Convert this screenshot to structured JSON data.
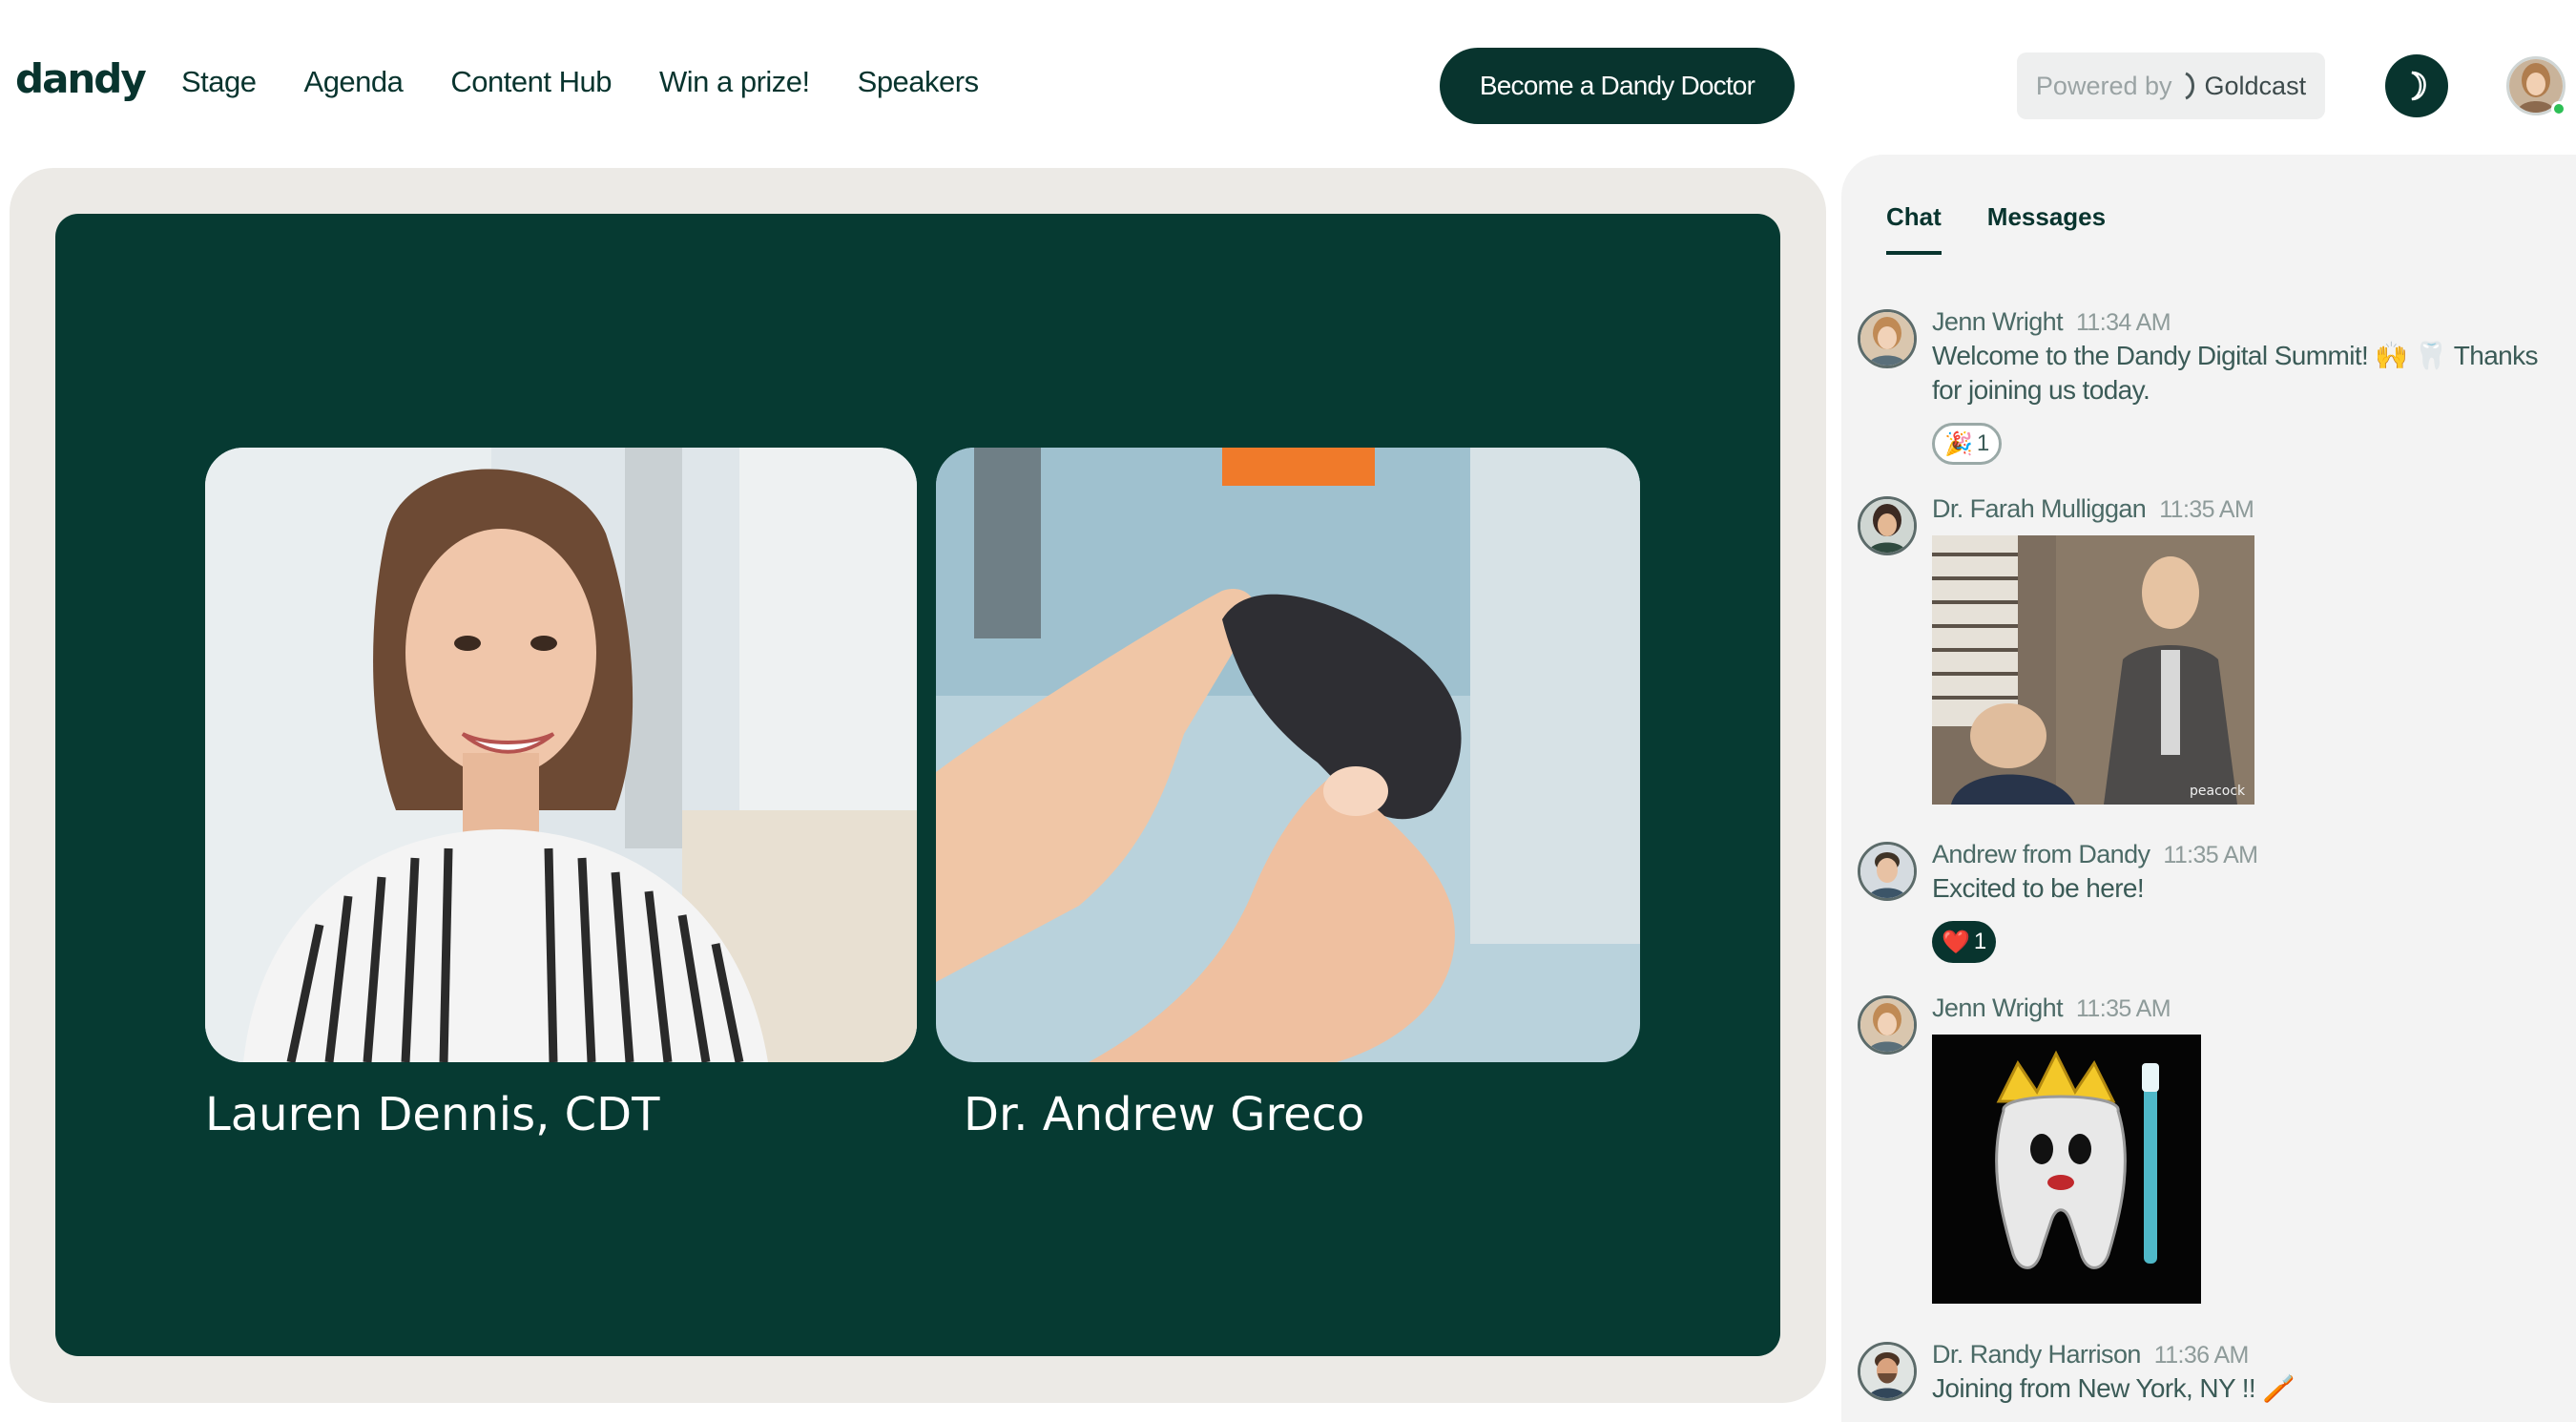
{
  "brand": {
    "logo": "dandy"
  },
  "nav": {
    "items": [
      "Stage",
      "Agenda",
      "Content Hub",
      "Win a prize!",
      "Speakers"
    ]
  },
  "header": {
    "cta_label": "Become a Dandy Doctor",
    "powered_label": "Powered by",
    "powered_brand": "Goldcast"
  },
  "stage": {
    "speakers": [
      {
        "name": "Lauren Dennis, CDT"
      },
      {
        "name": "Dr. Andrew Greco"
      }
    ]
  },
  "chat": {
    "tabs": [
      "Chat",
      "Messages"
    ],
    "messages": [
      {
        "author": "Jenn Wright",
        "time": "11:34 AM",
        "text": "Welcome to the Dandy Digital Summit! 🙌 🦷 Thanks for joining us today.",
        "reaction": "🎉",
        "reaction_count": "1"
      },
      {
        "author": "Dr. Farah Mulliggan",
        "time": "11:35 AM",
        "gif_watermark": "peacock"
      },
      {
        "author": "Andrew from Dandy",
        "time": "11:35 AM",
        "text": "Excited to be here!",
        "reaction": "❤️",
        "reaction_count": "1"
      },
      {
        "author": "Jenn Wright",
        "time": "11:35 AM"
      },
      {
        "author": "Dr. Randy Harrison",
        "time": "11:36 AM",
        "text": "Joining from New York, NY !! 🪥"
      }
    ]
  },
  "colors": {
    "brand_green": "#08342e",
    "stage_bg": "#063a32",
    "frame_bg": "#eceae6",
    "online": "#2dbf55"
  }
}
